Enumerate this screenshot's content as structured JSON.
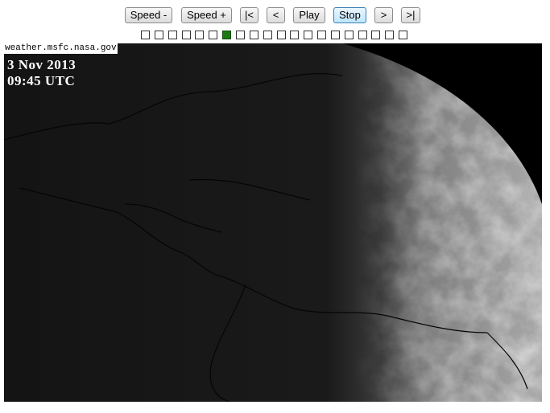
{
  "controls": {
    "speed_down": "Speed -",
    "speed_up": "Speed +",
    "first": "|<",
    "prev": "<",
    "play": "Play",
    "stop": "Stop",
    "next": ">",
    "last": ">|"
  },
  "frames": {
    "count": 20,
    "current_index": 6,
    "current_color": "#1d7a12"
  },
  "image": {
    "source_label": "weather.msfc.nasa.gov",
    "date": "3 Nov 2013",
    "time": "09:45 UTC"
  }
}
